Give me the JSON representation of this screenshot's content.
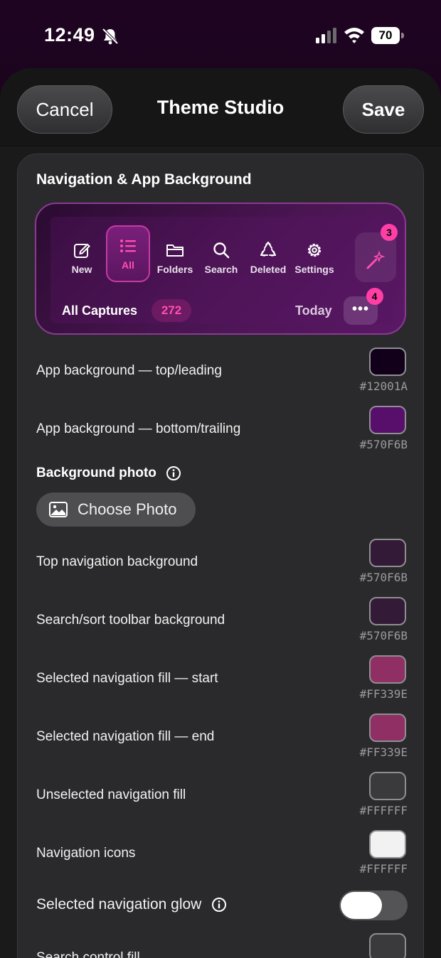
{
  "status_bar": {
    "time": "12:49",
    "battery": "70"
  },
  "header": {
    "cancel": "Cancel",
    "title": "Theme Studio",
    "save": "Save"
  },
  "section": {
    "title": "Navigation & App Background"
  },
  "preview": {
    "nav_items": [
      {
        "label": "New",
        "icon": "compose-icon"
      },
      {
        "label": "All",
        "icon": "list-icon",
        "selected": true
      },
      {
        "label": "Folders",
        "icon": "folder-icon"
      },
      {
        "label": "Search",
        "icon": "search-icon"
      },
      {
        "label": "Deleted",
        "icon": "recycle-icon"
      },
      {
        "label": "Settings",
        "icon": "gear-icon"
      }
    ],
    "magic_badge": "3",
    "captures_label": "All Captures",
    "captures_count": "272",
    "today_label": "Today",
    "more_label": "•••",
    "more_badge": "4"
  },
  "settings": {
    "app_bg_top": {
      "label": "App background — top/leading",
      "hex": "#12001A",
      "swatch": "#12001A"
    },
    "app_bg_bottom": {
      "label": "App background — bottom/trailing",
      "hex": "#570F6B",
      "swatch": "#570F6B"
    },
    "background_photo": {
      "title": "Background photo",
      "button": "Choose Photo"
    },
    "top_nav_bg": {
      "label": "Top navigation background",
      "hex": "#570F6B",
      "swatch": "#331a36"
    },
    "toolbar_bg": {
      "label": "Search/sort toolbar background",
      "hex": "#570F6B",
      "swatch": "#331a36"
    },
    "sel_fill_start": {
      "label": "Selected navigation fill — start",
      "hex": "#FF339E",
      "swatch": "#8f2f63"
    },
    "sel_fill_end": {
      "label": "Selected navigation fill — end",
      "hex": "#FF339E",
      "swatch": "#8f2f63"
    },
    "unsel_fill": {
      "label": "Unselected navigation fill",
      "hex": "#FFFFFF",
      "swatch": "#3a3a3c"
    },
    "nav_icons": {
      "label": "Navigation icons",
      "hex": "#FFFFFF",
      "swatch": "#f2f2f2"
    },
    "glow": {
      "label": "Selected navigation glow",
      "enabled": true
    },
    "search_fill": {
      "label": "Search control fill",
      "swatch": "#3a3a3c"
    }
  },
  "colors": {
    "accent": "#FF339E",
    "card": "#2a2a2c",
    "sheet": "#1a1a1b"
  }
}
